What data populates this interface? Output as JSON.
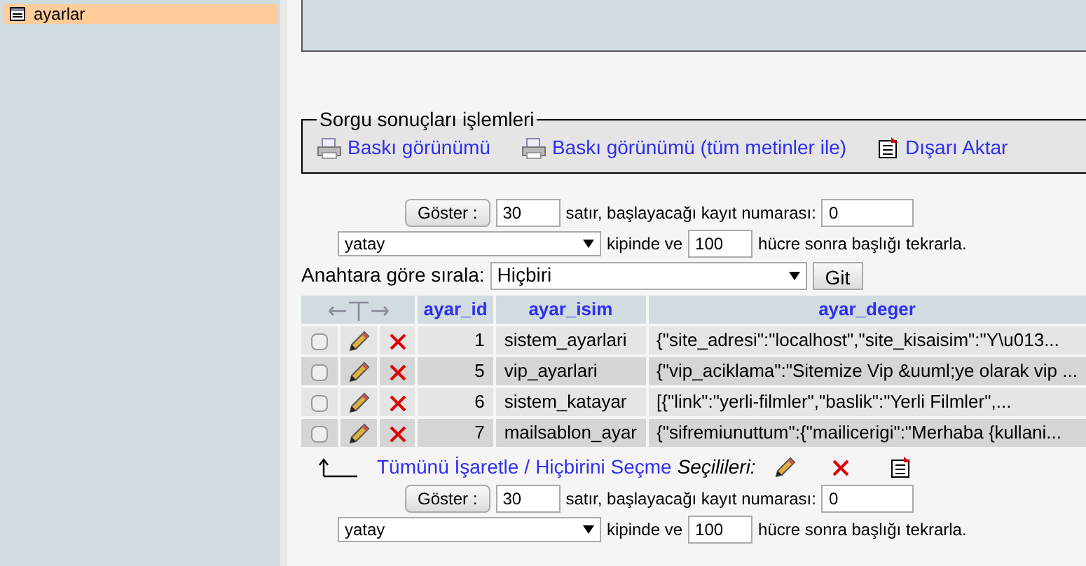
{
  "sidebar": {
    "items": [
      {
        "label": "ayarlar",
        "selected": true
      }
    ]
  },
  "query_ops": {
    "legend": "Sorgu sonuçları işlemleri",
    "links": [
      {
        "kind": "print",
        "label": "Baskı görünümü"
      },
      {
        "kind": "print",
        "label": "Baskı görünümü (tüm metinler ile)"
      },
      {
        "kind": "export",
        "label": "Dışarı Aktar"
      }
    ]
  },
  "navigation_top": {
    "show_button": "Göster :",
    "rows": "30",
    "rows_text": "satır, başlayacağı kayıt numarası:",
    "start": "0",
    "mode": "yatay",
    "mode_text": "kipinde ve",
    "repeat": "100",
    "repeat_text": "hücre sonra başlığı tekrarla."
  },
  "sort": {
    "label": "Anahtara göre sırala:",
    "value": "Hiçbiri",
    "button": "Git"
  },
  "table": {
    "columns": [
      "ayar_id",
      "ayar_isim",
      "ayar_deger"
    ],
    "rows": [
      {
        "checked": false,
        "cells": [
          "1",
          "sistem_ayarlari",
          "{\"site_adresi\":\"localhost\",\"site_kisaisim\":\"Y\\u013..."
        ]
      },
      {
        "checked": false,
        "cells": [
          "5",
          "vip_ayarlari",
          "{\"vip_aciklama\":\"Sitemize Vip &uuml;ye olarak vip ..."
        ]
      },
      {
        "checked": false,
        "cells": [
          "6",
          "sistem_katayar",
          "[{\"link\":\"yerli-filmler\",\"baslik\":\"Yerli Filmler\",..."
        ]
      },
      {
        "checked": false,
        "cells": [
          "7",
          "mailsablon_ayar",
          "{\"sifremiunuttum\":{\"mailicerigi\":\"Merhaba {kullani..."
        ]
      }
    ]
  },
  "bulk": {
    "check_all": "Tümünü İşaretle",
    "separator": "/",
    "uncheck_all": "Hiçbirini Seçme",
    "with_selected": "Seçilileri:"
  },
  "navigation_bottom": {
    "show_button": "Göster :",
    "rows": "30",
    "rows_text": "satır, başlayacağı kayıt numarası:",
    "start": "0",
    "mode": "yatay",
    "mode_text": "kipinde ve",
    "repeat": "100",
    "repeat_text": "hücre sonra başlığı tekrarla."
  }
}
